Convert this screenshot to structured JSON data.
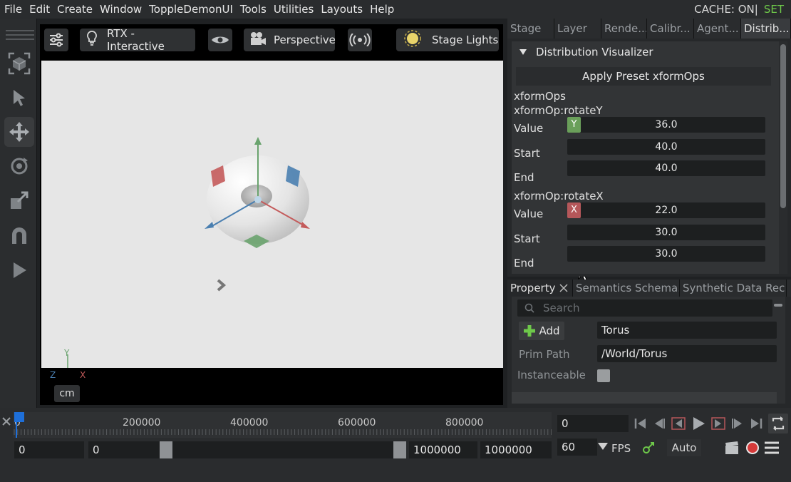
{
  "menubar": {
    "items": [
      "File",
      "Edit",
      "Create",
      "Window",
      "ToppleDemonUI",
      "Tools",
      "Utilities",
      "Layouts",
      "Help"
    ],
    "cache_status": "CACHE: ON|",
    "set_label": "SET"
  },
  "viewport": {
    "render_mode": "RTX - Interactive",
    "camera": "Perspective",
    "lights": "Stage Lights",
    "units": "cm",
    "axis_labels": {
      "x": "X",
      "y": "Y",
      "z": "Z"
    }
  },
  "top_dock": {
    "tabs": [
      "Stage",
      "Layer",
      "Rende...",
      "Calibr...",
      "Agent...",
      "Distrib..."
    ],
    "active_tab": "Distrib...",
    "panel_title": "Distribution Visualizer",
    "apply_button": "Apply Preset xformOps",
    "section_label": "xformOps",
    "ops": [
      {
        "name": "xformOp:rotateY",
        "axis": "Y",
        "axis_color": "#6a9f5a",
        "value_label": "Value",
        "value": "36.0",
        "start_label": "Start",
        "start": "40.0",
        "end_label": "End",
        "end": "40.0"
      },
      {
        "name": "xformOp:rotateX",
        "axis": "X",
        "axis_color": "#b5575a",
        "value_label": "Value",
        "value": "22.0",
        "start_label": "Start",
        "start": "30.0",
        "end_label": "End",
        "end": "30.0"
      }
    ]
  },
  "bottom_dock": {
    "tabs": [
      "Property",
      "Semantics Schema...",
      "Synthetic Data Rec..."
    ],
    "active_tab": "Property",
    "search_placeholder": "Search",
    "add_button": "Add",
    "prim_name": "Torus",
    "prim_path_label": "Prim Path",
    "prim_path": "/World/Torus",
    "instanceable_label": "Instanceable",
    "instanceable": false
  },
  "timeline": {
    "ticks": [
      "0",
      "200000",
      "400000",
      "600000",
      "800000"
    ],
    "current_frame": "0",
    "start_field": "0",
    "range_start": "0",
    "range_end": "1000000",
    "end_field": "1000000",
    "fps_value": "60",
    "fps_label": "FPS",
    "auto_label": "Auto"
  }
}
